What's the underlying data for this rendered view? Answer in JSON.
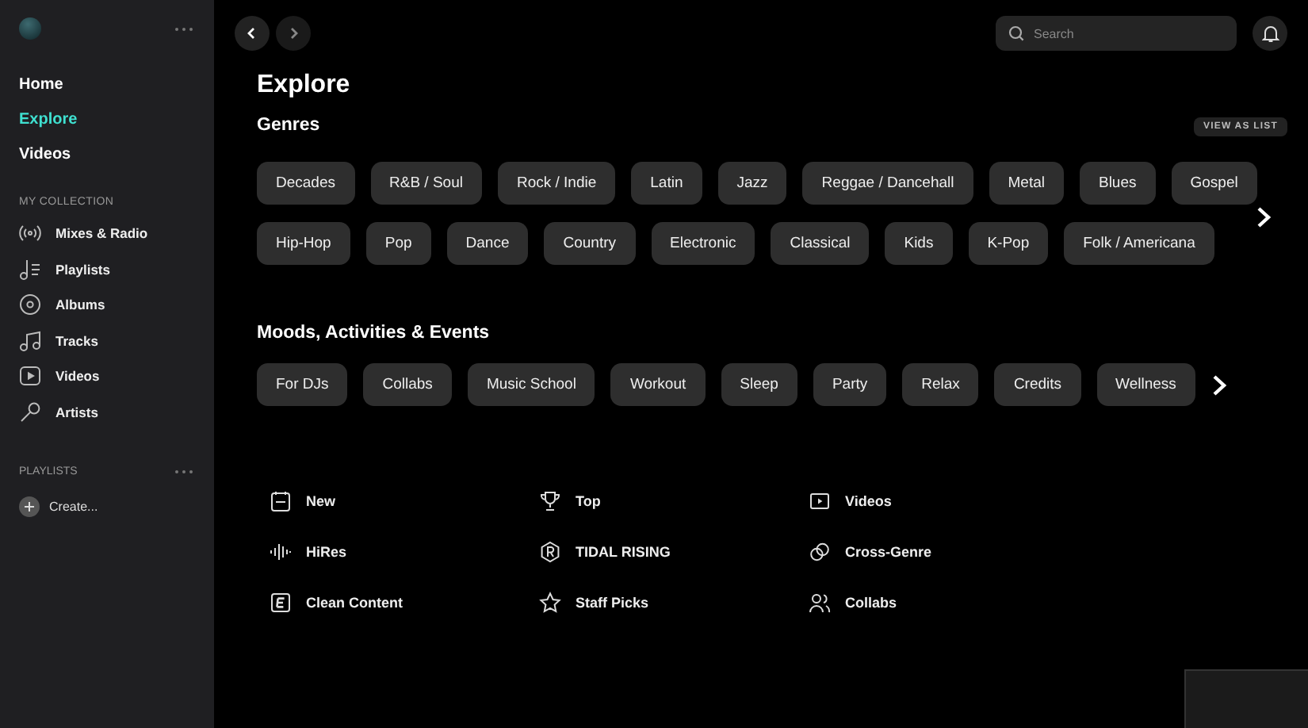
{
  "sidebar": {
    "nav": [
      {
        "label": "Home",
        "selected": false
      },
      {
        "label": "Explore",
        "selected": true
      },
      {
        "label": "Videos",
        "selected": false
      }
    ],
    "collection_heading": "MY COLLECTION",
    "collection": [
      {
        "label": "Mixes & Radio",
        "kind": "radio"
      },
      {
        "label": "Playlists",
        "kind": "playlist"
      },
      {
        "label": "Albums",
        "kind": "album"
      },
      {
        "label": "Tracks",
        "kind": "tracks"
      },
      {
        "label": "Videos",
        "kind": "video"
      },
      {
        "label": "Artists",
        "kind": "mic"
      }
    ],
    "playlists_heading": "PLAYLISTS",
    "create_label": "Create..."
  },
  "topbar": {
    "search": {
      "placeholder": "Search"
    }
  },
  "title": "Explore",
  "genres": {
    "heading": "Genres",
    "view_button": "VIEW AS LIST",
    "rows": [
      {
        "chips": [
          "Decades",
          "R&B / Soul",
          "Rock / Indie",
          "Latin",
          "Jazz",
          "Reggae / Dancehall",
          "Metal",
          "Blues",
          "Gospel"
        ]
      },
      {
        "chips": [
          "Hip-Hop",
          "Pop",
          "Dance",
          "Country",
          "Electronic",
          "Classical",
          "Kids",
          "K-Pop",
          "Folk / Americana"
        ]
      }
    ]
  },
  "moods": {
    "heading": "Moods, Activities & Events",
    "chips": [
      "For DJs",
      "Collabs",
      "Music School",
      "Workout",
      "Sleep",
      "Party",
      "Relax",
      "Credits",
      "Wellness"
    ]
  },
  "links": [
    {
      "label": "New",
      "kind": "calendar"
    },
    {
      "label": "Top",
      "kind": "trophy"
    },
    {
      "label": "Videos",
      "kind": "video"
    },
    {
      "label": "HiRes",
      "kind": "wave"
    },
    {
      "label": "TIDAL RISING",
      "kind": "rising"
    },
    {
      "label": "Cross-Genre",
      "kind": "rings"
    },
    {
      "label": "Clean Content",
      "kind": "clean"
    },
    {
      "label": "Staff Picks",
      "kind": "star"
    },
    {
      "label": "Collabs",
      "kind": "people"
    }
  ]
}
